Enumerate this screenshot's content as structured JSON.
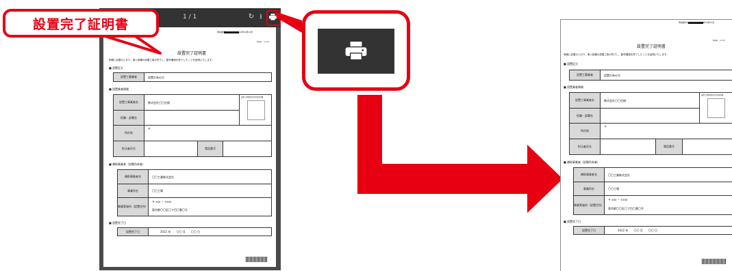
{
  "callout": {
    "title": "設置完了証明書"
  },
  "viewer": {
    "page_count": "1 / 1",
    "print_icon": "print-icon"
  },
  "doc": {
    "header_small": "申請番号 ■■■■■ 2022年00月00日",
    "page_no": "Page : 1-1/1",
    "title": "設置完了証明書",
    "intro": "明細に記載のとおり、導入設備の設置工事が完了し、動作確認を終了したことを証明いたします。",
    "sec1": "設置区分",
    "sec1_label": "設置工事業者",
    "sec1_value": "設置の有の方",
    "sec2": "設置業者情報",
    "company_label": "設置工事業者名",
    "company_value": "株式会社〇〇空調",
    "position_label": "役職・部署名",
    "address_label": "所在地",
    "address_value": "〒",
    "person_label": "担当者氏名",
    "tel_label": "電話番号",
    "stamp_label": "設置工事業者社印(代表印)欄",
    "sec3": "補助事業者（設備所有者）",
    "owner_label": "補助事業者名",
    "owner_value": "〇〇工業株式会社",
    "office_label": "事業所名",
    "office_value": "〇〇工場",
    "site_label": "事業実施所（設置住所）",
    "site_zip": "〒 xxx － xxxx",
    "site_value": "東京都〇〇区〇丁目〇番〇号",
    "sec4": "設置完了日",
    "date_label": "設置完了日",
    "date_value": "2022 年　　〇〇 月　　〇〇 日"
  },
  "colors": {
    "accent": "#e60012",
    "toolbar": "#333333"
  }
}
